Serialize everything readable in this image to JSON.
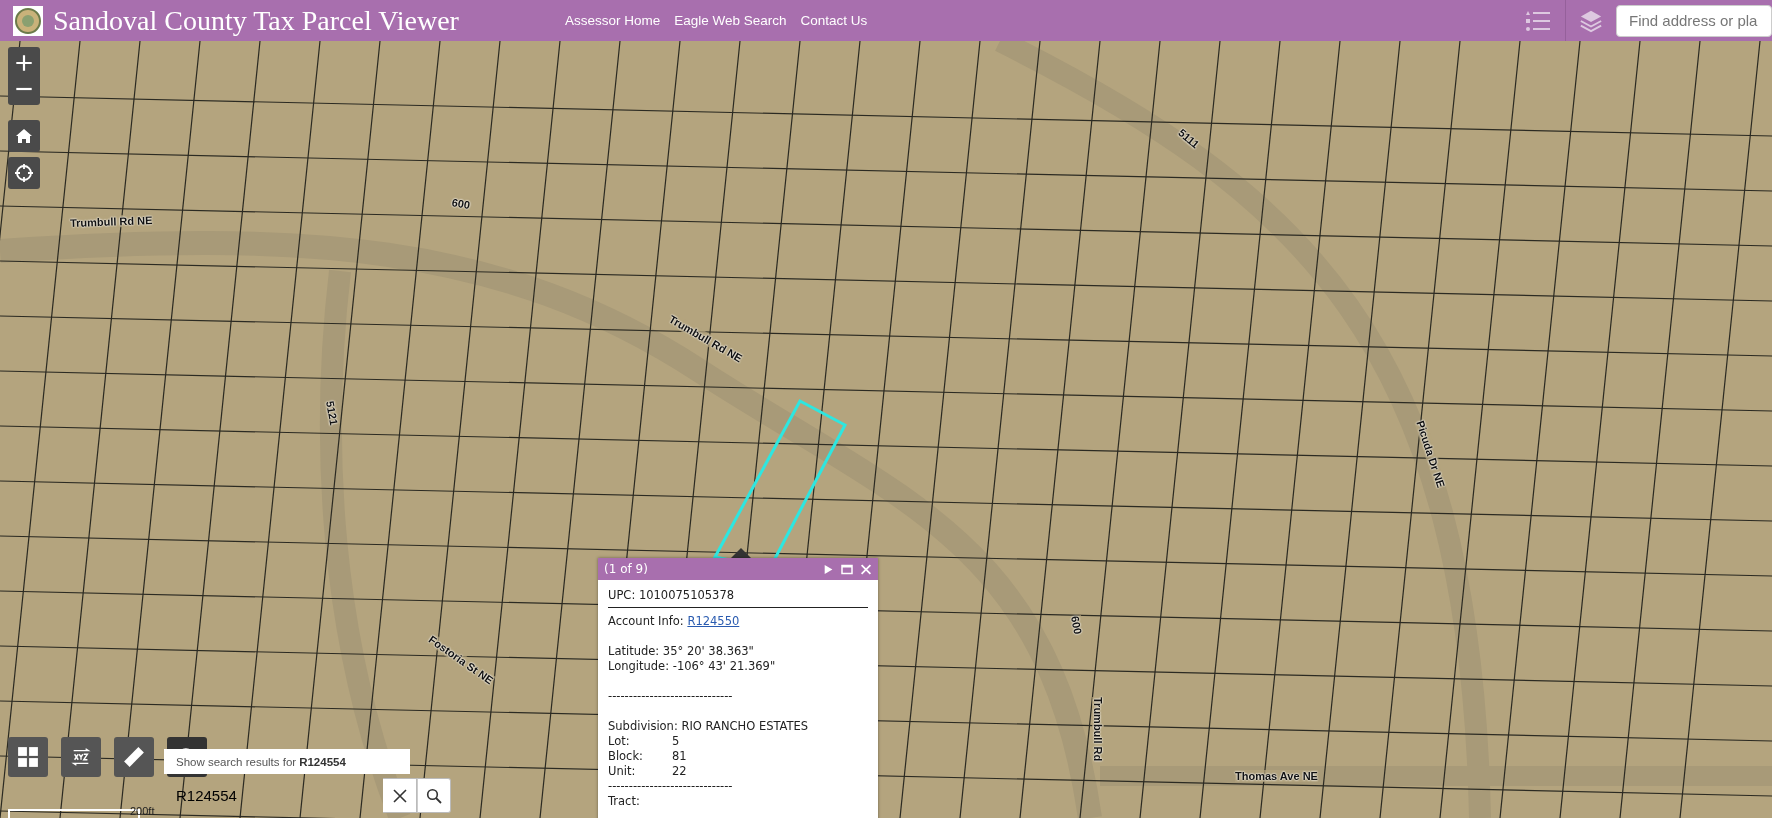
{
  "header": {
    "title": "Sandoval County Tax Parcel Viewer",
    "links": [
      "Assessor Home",
      "Eagle Web Search",
      "Contact Us"
    ],
    "search": {
      "placeholder": "Find address or pla"
    }
  },
  "map": {
    "labels": [
      {
        "text": "Trumbull Rd NE"
      },
      {
        "text": "600"
      },
      {
        "text": "Trumbull Rd NE"
      },
      {
        "text": "5121"
      },
      {
        "text": "Fostoria St NE"
      },
      {
        "text": "600"
      },
      {
        "text": "5111"
      },
      {
        "text": "Picuda Dr NE"
      },
      {
        "text": "Trumbull Rd"
      },
      {
        "text": "Thomas Ave NE"
      }
    ],
    "scale": "200ft"
  },
  "popup": {
    "counter": "(1 of 9)",
    "upc": "UPC: 1010075105378",
    "account_label": "Account Info: ",
    "account_link": "R124550",
    "latitude": "Latitude: 35° 20' 38.363\"",
    "longitude": "Longitude: -106° 43' 21.369\"",
    "divider": "------------------------------",
    "subdivision": "Subdivision: RIO RANCHO ESTATES",
    "fields": [
      {
        "label": "Lot:",
        "value": "5"
      },
      {
        "label": "Block:",
        "value": "81"
      },
      {
        "label": "Unit:",
        "value": "22"
      }
    ],
    "divider2": "------------------------------",
    "tract": "Tract:"
  },
  "search_widget": {
    "suggestion_prefix": "Show search results for ",
    "suggestion_term": "R124554",
    "value": "R124554"
  }
}
